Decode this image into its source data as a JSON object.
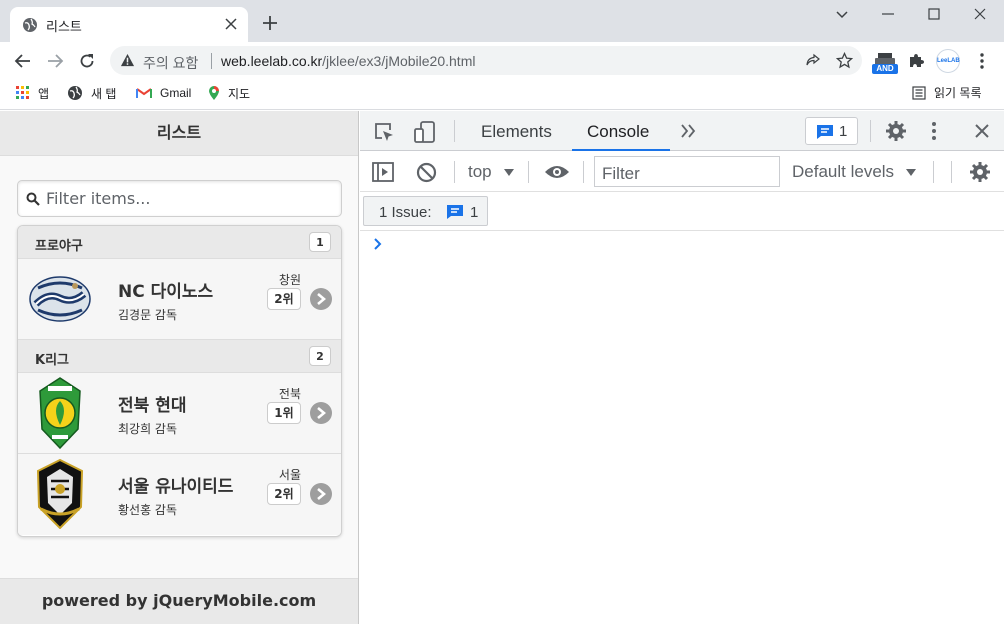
{
  "browser": {
    "tab_title": "리스트",
    "security_label": "주의 요함",
    "url_host": "web.leelab.co.kr",
    "url_path": "/jklee/ex3/jMobile20.html",
    "extension_badge": "AND",
    "extension_leelab": "LeeLAB",
    "bookmarks": [
      {
        "label": "앱",
        "icon": "apps-grid-icon"
      },
      {
        "label": "새 탭",
        "icon": "globe-icon"
      },
      {
        "label": "Gmail",
        "icon": "gmail-icon"
      },
      {
        "label": "지도",
        "icon": "maps-pin-icon"
      }
    ],
    "reading_list_label": "읽기 목록"
  },
  "page": {
    "header_title": "리스트",
    "filter_placeholder": "Filter items...",
    "groups": [
      {
        "title": "프로야구",
        "count": "1",
        "items": [
          {
            "team": "NC 다이노스",
            "coach": "김경문 감독",
            "city": "창원",
            "rank": "2위",
            "logo": "nc-dinos-logo"
          }
        ]
      },
      {
        "title": "K리그",
        "count": "2",
        "items": [
          {
            "team": "전북 현대",
            "coach": "최강희 감독",
            "city": "전북",
            "rank": "1위",
            "logo": "jeonbuk-logo"
          },
          {
            "team": "서울 유나이티드",
            "coach": "황선홍 감독",
            "city": "서울",
            "rank": "2위",
            "logo": "seoul-united-logo"
          }
        ]
      }
    ],
    "footer_text": "powered by jQueryMobile.com"
  },
  "devtools": {
    "tabs": [
      "Elements",
      "Console"
    ],
    "active_tab": "Console",
    "issues_count": "1",
    "context": "top",
    "filter_placeholder": "Filter",
    "levels": "Default levels",
    "issues_label": "1 Issue:",
    "issues_num": "1",
    "colors": {
      "accent": "#1a73e8",
      "prompt": "#1a73e8"
    }
  }
}
